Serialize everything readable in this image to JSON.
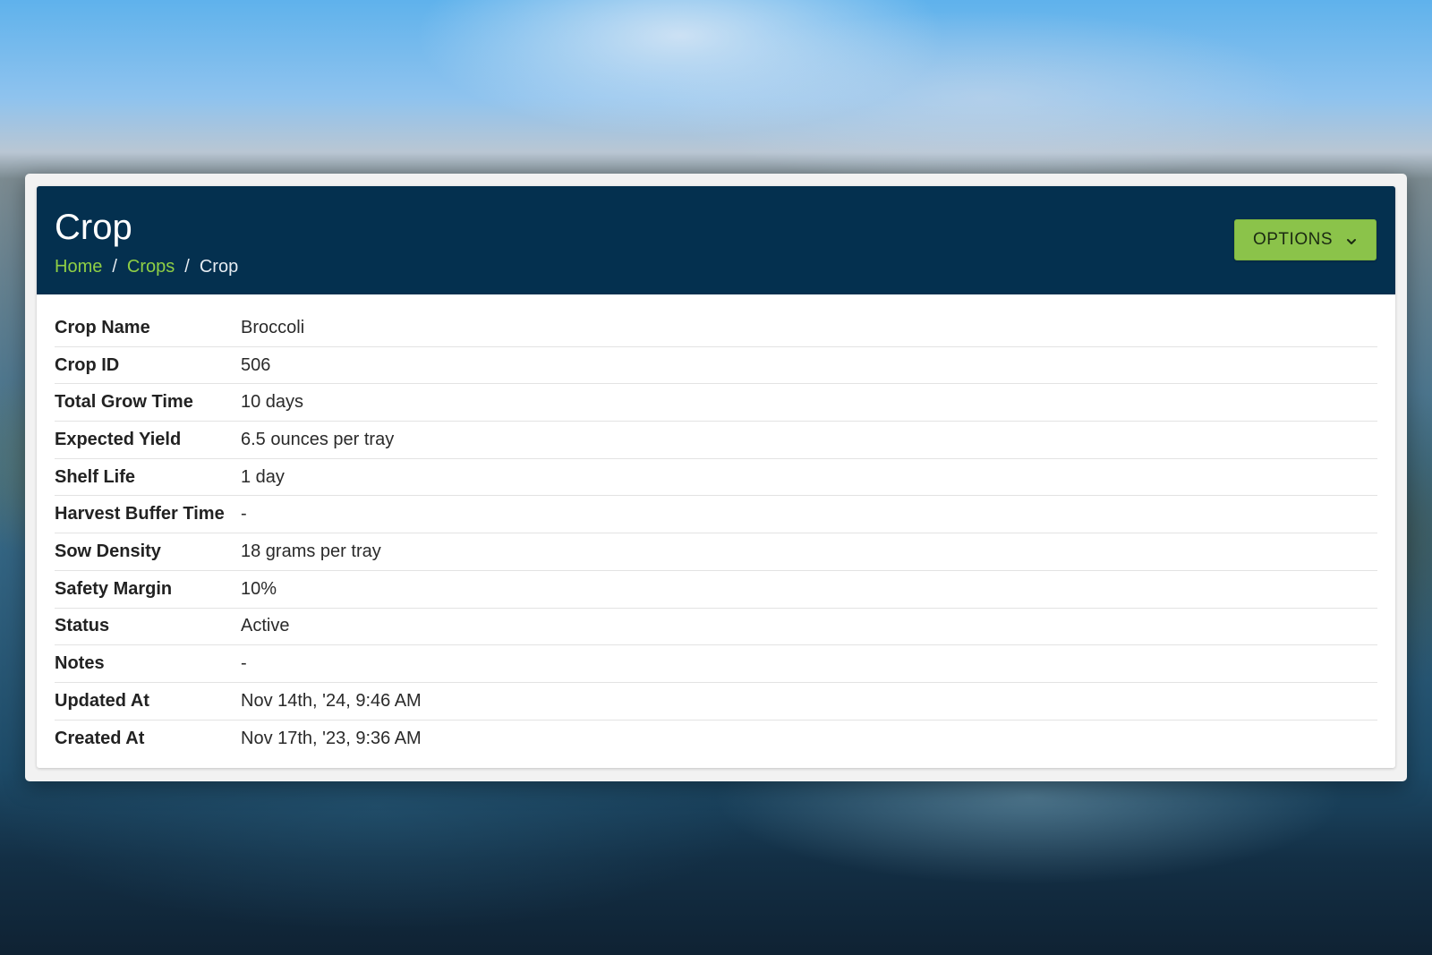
{
  "colors": {
    "header_bg": "#04304f",
    "link": "#8fcf45",
    "button_bg": "#8bc34a"
  },
  "header": {
    "title": "Crop",
    "breadcrumb": {
      "home": "Home",
      "crops": "Crops",
      "current": "Crop",
      "separator": "/"
    },
    "options_label": "OPTIONS",
    "options_icon": "chevron-down-icon"
  },
  "details": [
    {
      "label": "Crop Name",
      "value": "Broccoli"
    },
    {
      "label": "Crop ID",
      "value": "506"
    },
    {
      "label": "Total Grow Time",
      "value": "10 days"
    },
    {
      "label": "Expected Yield",
      "value": "6.5 ounces per tray"
    },
    {
      "label": "Shelf Life",
      "value": "1 day"
    },
    {
      "label": "Harvest Buffer Time",
      "value": "-"
    },
    {
      "label": "Sow Density",
      "value": "18 grams per tray"
    },
    {
      "label": "Safety Margin",
      "value": "10%"
    },
    {
      "label": "Status",
      "value": "Active"
    },
    {
      "label": "Notes",
      "value": "-"
    },
    {
      "label": "Updated At",
      "value": "Nov 14th, '24, 9:46 AM"
    },
    {
      "label": "Created At",
      "value": "Nov 17th, '23, 9:36 AM"
    }
  ]
}
